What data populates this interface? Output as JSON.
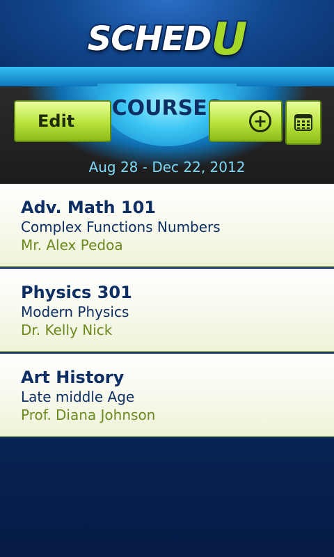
{
  "app": {
    "logo_main": "SCHED",
    "logo_accent": "U"
  },
  "header": {
    "title": "COURSES",
    "edit_label": "Edit",
    "add_icon": "plus-circle-icon",
    "calendar_icon": "calendar-grid-icon",
    "date_range": "Aug 28 - Dec 22, 2012"
  },
  "courses": [
    {
      "name": "Adv. Math 101",
      "subtitle": "Complex Functions Numbers",
      "instructor": "Mr. Alex Pedoa"
    },
    {
      "name": "Physics 301",
      "subtitle": "Modern Physics",
      "instructor": "Dr. Kelly Nick"
    },
    {
      "name": "Art History",
      "subtitle": "Late middle Age",
      "instructor": "Prof. Diana Johnson"
    }
  ],
  "colors": {
    "brand_blue": "#0e2f63",
    "accent_green": "#b9e33c",
    "instructor_green": "#6b8a1d",
    "date_cyan": "#7fdaf8"
  }
}
